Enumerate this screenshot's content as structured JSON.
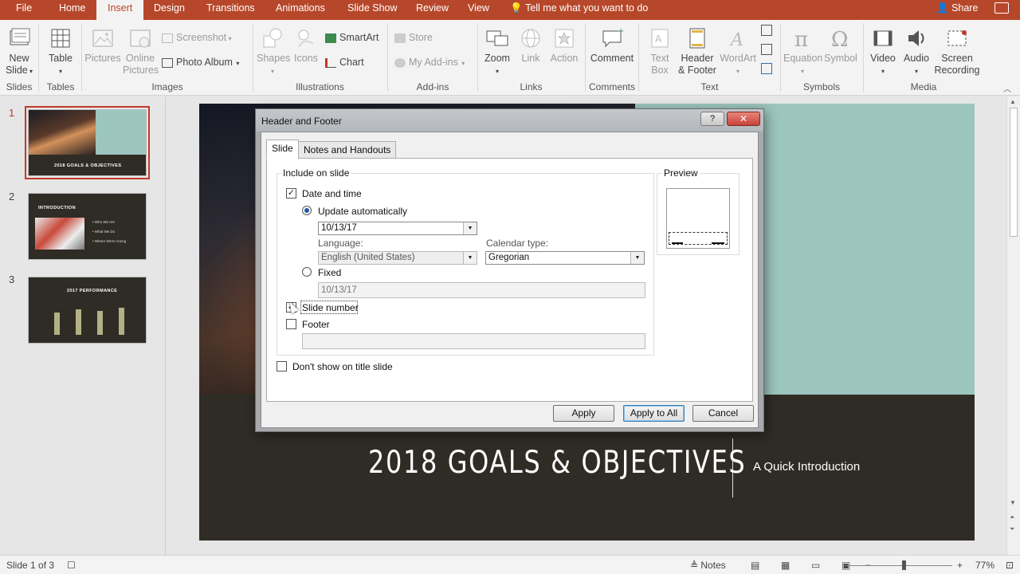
{
  "tabs": [
    "File",
    "Home",
    "Insert",
    "Design",
    "Transitions",
    "Animations",
    "Slide Show",
    "Review",
    "View"
  ],
  "active_tab": "Insert",
  "tellme": "Tell me what you want to do",
  "share": "Share",
  "ribbon": {
    "new_slide": "New Slide",
    "table": "Table",
    "pictures": "Pictures",
    "online_pictures": "Online Pictures",
    "screenshot": "Screenshot",
    "photo_album": "Photo Album",
    "shapes": "Shapes",
    "icons": "Icons",
    "smartart": "SmartArt",
    "chart": "Chart",
    "store": "Store",
    "my_addins": "My Add-ins",
    "zoom": "Zoom",
    "link": "Link",
    "action": "Action",
    "comment": "Comment",
    "text_box": "Text Box",
    "header_footer": "Header & Footer",
    "wordart": "WordArt",
    "equation": "Equation",
    "symbol": "Symbol",
    "video": "Video",
    "audio": "Audio",
    "screen_recording": "Screen Recording",
    "groups": [
      "Slides",
      "Tables",
      "Images",
      "Illustrations",
      "Add-ins",
      "Links",
      "Comments",
      "Text",
      "Symbols",
      "Media"
    ]
  },
  "thumbnails": [
    {
      "num": "1",
      "title": "2018 GOALS & OBJECTIVES"
    },
    {
      "num": "2",
      "title": "INTRODUCTION",
      "bullets": [
        "• Who We Are",
        "• What We Do",
        "• Where We're Going"
      ]
    },
    {
      "num": "3",
      "title": "2017 PERFORMANCE"
    }
  ],
  "slide": {
    "title": "2018 GOALS & OBJECTIVES",
    "subtitle": "A Quick Introduction"
  },
  "dialog": {
    "title": "Header and Footer",
    "help": "?",
    "close": "✕",
    "tabs": [
      "Slide",
      "Notes and Handouts"
    ],
    "include_legend": "Include on slide",
    "date_time": {
      "label": "Date and time",
      "checked": true
    },
    "update_auto": {
      "label": "Update automatically",
      "selected": true
    },
    "date_value": "10/13/17",
    "language_label": "Language:",
    "language_value": "English (United States)",
    "calendar_label": "Calendar type:",
    "calendar_value": "Gregorian",
    "fixed": {
      "label": "Fixed",
      "selected": false
    },
    "fixed_value": "10/13/17",
    "slide_number": {
      "label": "Slide number",
      "checked": true
    },
    "footer": {
      "label": "Footer",
      "checked": false
    },
    "footer_value": "",
    "dont_show": {
      "label": "Don't show on title slide",
      "checked": false
    },
    "preview_legend": "Preview",
    "buttons": {
      "apply": "Apply",
      "apply_all": "Apply to All",
      "cancel": "Cancel"
    }
  },
  "status": {
    "slide_info": "Slide 1 of 3",
    "notes": "Notes",
    "zoom": "77%"
  }
}
